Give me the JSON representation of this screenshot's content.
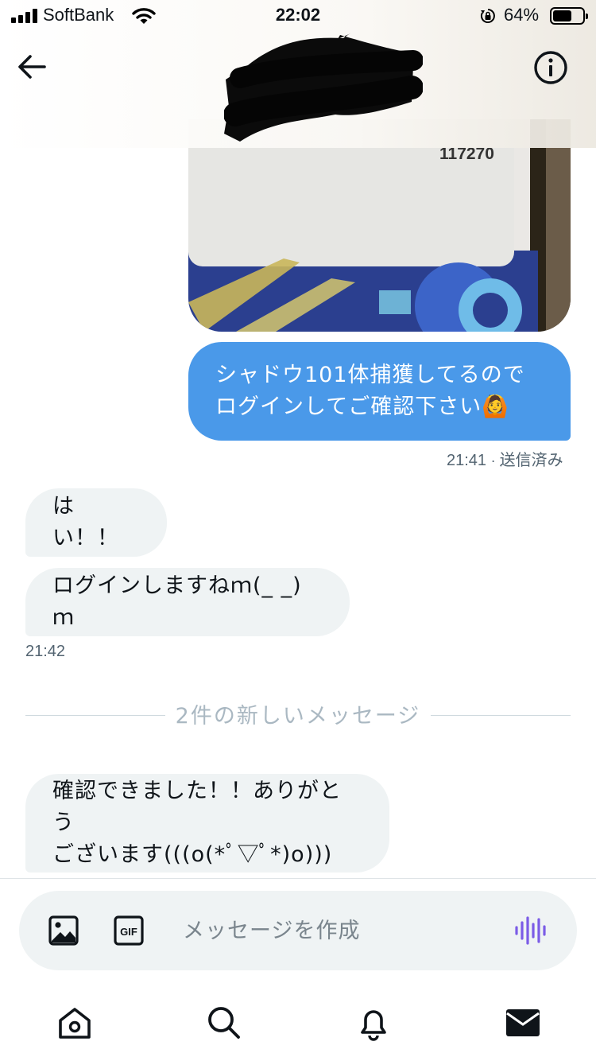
{
  "status_bar": {
    "carrier": "SoftBank",
    "time": "22:02",
    "battery_percent": "64%",
    "battery_level": 0.64,
    "icons": [
      "cellular-signal-icon",
      "wifi-icon",
      "rotation-lock-icon",
      "battery-icon"
    ]
  },
  "header": {
    "back_icon": "arrow-left-icon",
    "info_icon": "info-icon",
    "conversation_name": "redacted"
  },
  "messages": {
    "photo": {
      "visible_text": "117270"
    },
    "outgoing_text_line1": "シャドウ101体捕獲してるので",
    "outgoing_text_line2": "ログインしてご確認下さい🙆",
    "outgoing_time": "21:41",
    "outgoing_status": "送信済み",
    "incoming_1": "はい！！",
    "incoming_2": "ログインしますねｍ(_ _)ｍ",
    "incoming_time": "21:42",
    "new_messages_divider": "2件の新しいメッセージ",
    "incoming_3_line1": "確認できました！！ありがとう",
    "incoming_3_line2": "ございます(((o(*ﾟ▽ﾟ*)o)))"
  },
  "composer": {
    "placeholder": "メッセージを作成",
    "icons": [
      "image-icon",
      "gif-icon",
      "voice-wave-icon"
    ]
  },
  "bottom_nav": {
    "tabs": [
      "home-icon",
      "search-icon",
      "notifications-icon",
      "messages-icon"
    ],
    "active_tab": "messages-icon"
  },
  "colors": {
    "outgoing_bubble": "#4a99e9",
    "incoming_bubble": "#eff3f4",
    "meta_text": "#536471",
    "divider_text": "#aab8c2",
    "voice_accent": "#7b5ce6"
  }
}
